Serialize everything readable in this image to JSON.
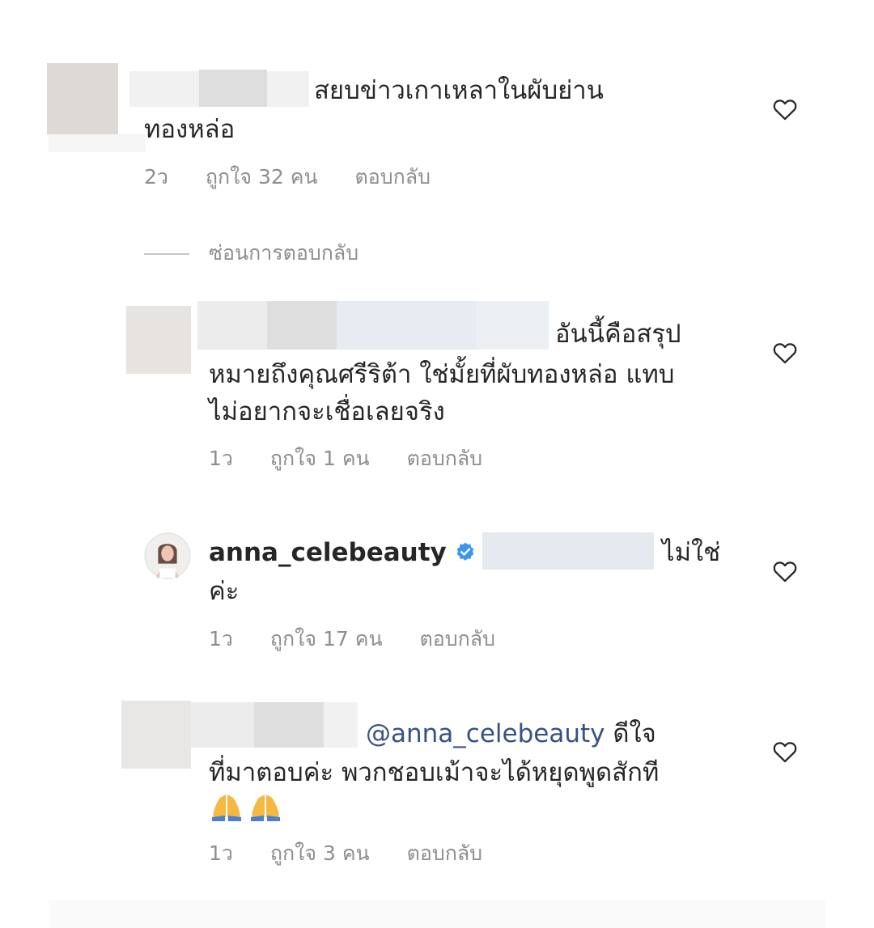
{
  "comments": [
    {
      "text_line1": "สยบข่าวเกาเหลาในผับย่าน",
      "text_line2": "ทองหล่อ",
      "time": "2ว",
      "likes": "ถูกใจ 32 คน",
      "reply": "ตอบกลับ"
    }
  ],
  "hide_replies_label": "ซ่อนการตอบกลับ",
  "replies": [
    {
      "text_line1": "อันนี้คือสรุป",
      "text_line2": "หมายถึงคุณศรีริต้า ใช่มั้ยที่ผับทองหล่อ แทบ",
      "text_line3": "ไม่อยากจะเชื่อเลยจริง",
      "time": "1ว",
      "likes": "ถูกใจ 1 คน",
      "reply": "ตอบกลับ"
    },
    {
      "username": "anna_celebeauty",
      "text_line1": "ไม่ใช่",
      "text_line2": "ค่ะ",
      "time": "1ว",
      "likes": "ถูกใจ 17 คน",
      "reply": "ตอบกลับ"
    },
    {
      "mention": "@anna_celebeauty",
      "text_line1": "ดีใจ",
      "text_line2": "ที่มาตอบค่ะ พวกชอบเม้าจะได้หยุดพูดสักที",
      "time": "1ว",
      "likes": "ถูกใจ 3 คน",
      "reply": "ตอบกลับ"
    }
  ],
  "icons": {
    "like": "heart-outline-icon",
    "verified": "verified-badge-icon",
    "emoji": "folded-hands-emoji"
  },
  "colors": {
    "text": "#262626",
    "meta": "#8e8e8e",
    "mention": "#385185",
    "verified": "#3897f0"
  }
}
